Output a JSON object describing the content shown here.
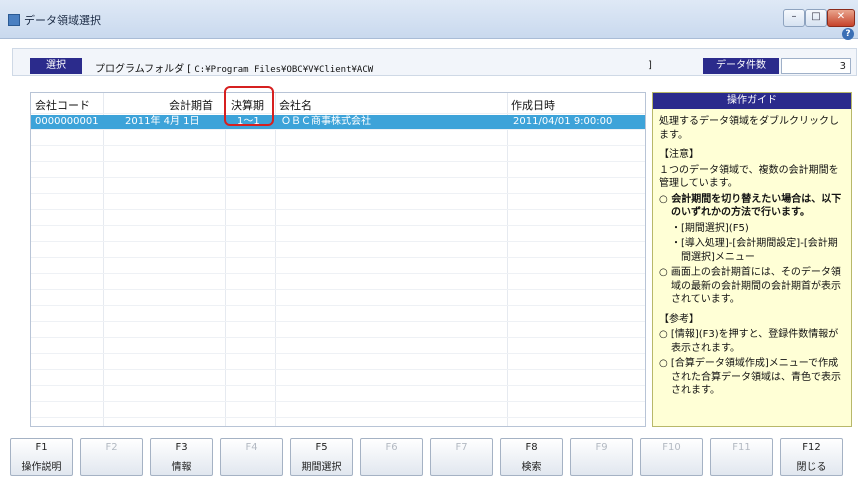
{
  "window": {
    "title": "データ領域選択",
    "min": "–",
    "max": "□",
    "close": "✕",
    "help": "?"
  },
  "folder": {
    "select_label": "選択",
    "prefix": "プログラムフォルダ [ ",
    "path": "C:¥Program Files¥OBC¥V¥Client¥ACW",
    "suffix": "]",
    "count_label": "データ件数",
    "count_value": "3"
  },
  "table": {
    "columns": [
      "会社コード",
      "会計期首",
      "決算期",
      "会社名",
      "作成日時"
    ],
    "rows": [
      {
        "code": "0000000001",
        "start": "2011年  4月  1日",
        "period": "1～1",
        "name": "ＯＢＣ商事株式会社",
        "created": "2011/04/01  9:00:00"
      }
    ]
  },
  "guide": {
    "title": "操作ガイド",
    "intro": "処理するデータ領域をダブルクリックします。",
    "note_head": "【注意】",
    "note_text": "１つのデータ領域で、複数の会計期間を管理しています。",
    "b1": "会計期間を切り替えたい場合は、以下のいずれかの方法で行います。",
    "s1": "[期間選択](F5)",
    "s2": "[導入処理]-[会計期間設定]-[会計期間選択]メニュー",
    "b2": "画面上の会計期首には、そのデータ領域の最新の会計期間の会計期首が表示されています。",
    "ref_head": "【参考】",
    "b3": "[情報](F3)を押すと、登録件数情報が表示されます。",
    "b4": "[合算データ領域作成]メニューで作成された合算データ領域は、青色で表示されます。",
    "bullet": "○",
    "dot": "・"
  },
  "fkeys": [
    {
      "num": "F1",
      "label": "操作説明",
      "enabled": true
    },
    {
      "num": "F2",
      "label": "",
      "enabled": false
    },
    {
      "num": "F3",
      "label": "情報",
      "enabled": true
    },
    {
      "num": "F4",
      "label": "",
      "enabled": false
    },
    {
      "num": "F5",
      "label": "期間選択",
      "enabled": true
    },
    {
      "num": "F6",
      "label": "",
      "enabled": false
    },
    {
      "num": "F7",
      "label": "",
      "enabled": false
    },
    {
      "num": "F8",
      "label": "検索",
      "enabled": true
    },
    {
      "num": "F9",
      "label": "",
      "enabled": false
    },
    {
      "num": "F10",
      "label": "",
      "enabled": false
    },
    {
      "num": "F11",
      "label": "",
      "enabled": false
    },
    {
      "num": "F12",
      "label": "閉じる",
      "enabled": true
    }
  ],
  "colors": {
    "header_blue": "#2b2b8c",
    "selected_row": "#3da3d9",
    "guide_bg": "#ffffd6",
    "highlight": "#d62020"
  }
}
